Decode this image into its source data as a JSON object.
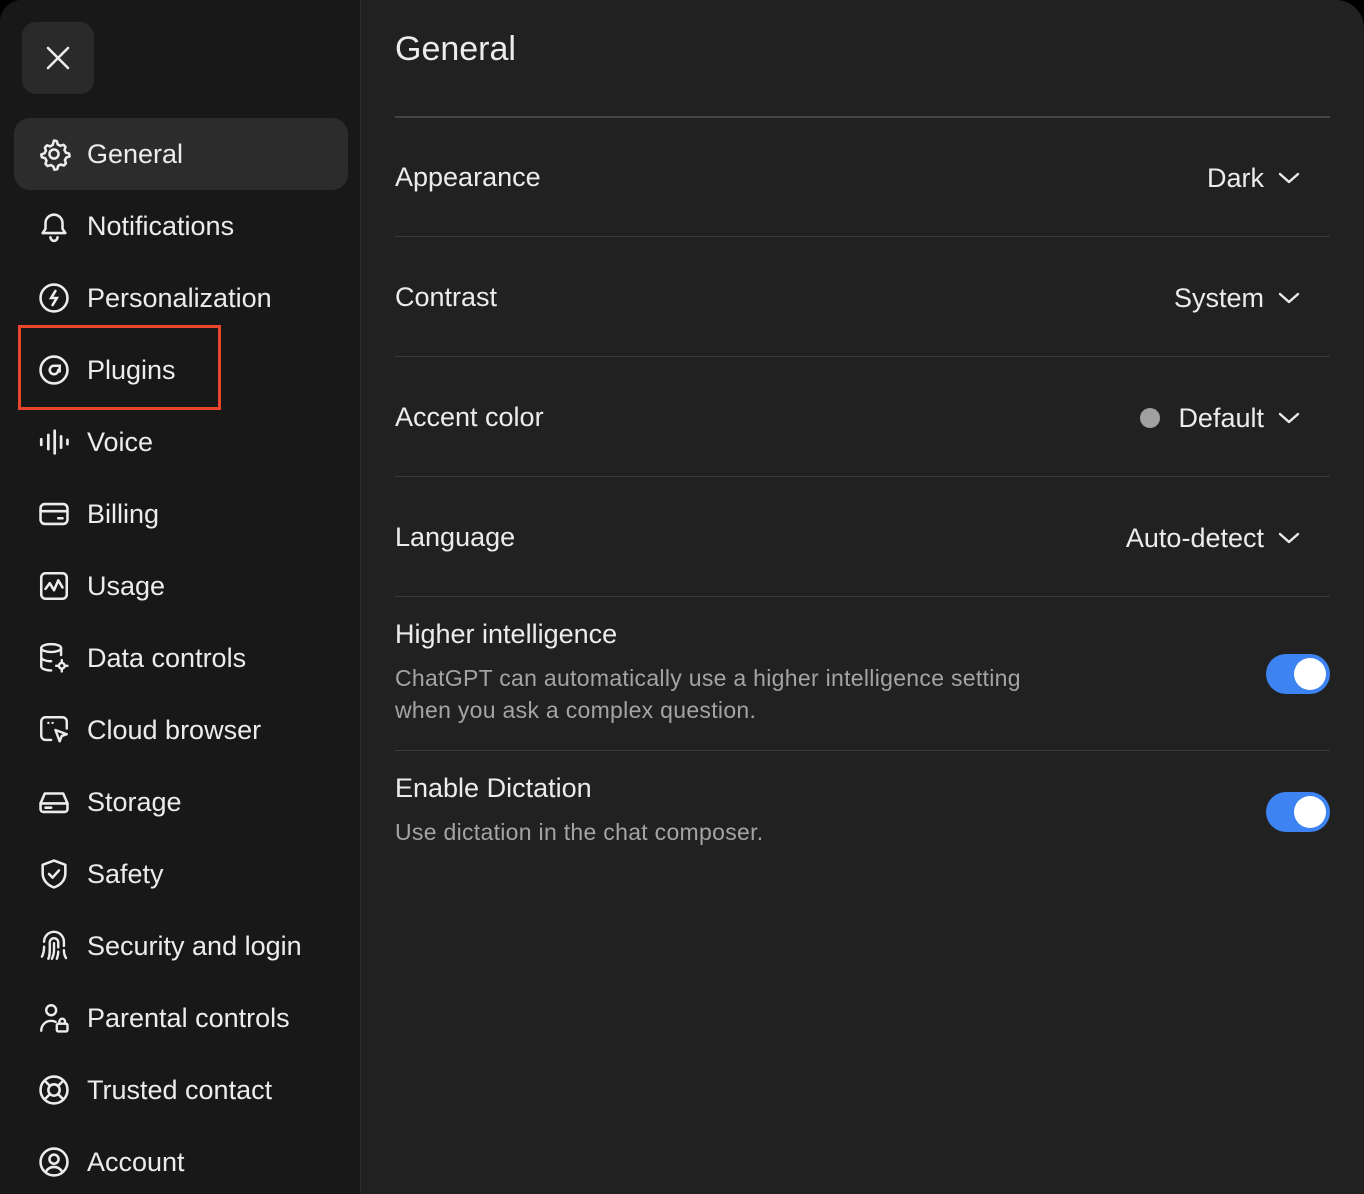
{
  "window": {
    "close_icon": "x-icon"
  },
  "sidebar": {
    "items": [
      {
        "label": "General",
        "icon": "gear-icon",
        "active": true
      },
      {
        "label": "Notifications",
        "icon": "bell-icon"
      },
      {
        "label": "Personalization",
        "icon": "personalization-icon"
      },
      {
        "label": "Plugins",
        "icon": "plugins-icon"
      },
      {
        "label": "Voice",
        "icon": "voice-waveform-icon"
      },
      {
        "label": "Billing",
        "icon": "credit-card-icon"
      },
      {
        "label": "Usage",
        "icon": "usage-chart-icon"
      },
      {
        "label": "Data controls",
        "icon": "database-gear-icon"
      },
      {
        "label": "Cloud browser",
        "icon": "cloud-browser-icon"
      },
      {
        "label": "Storage",
        "icon": "storage-drive-icon"
      },
      {
        "label": "Safety",
        "icon": "shield-check-icon"
      },
      {
        "label": "Security and login",
        "icon": "security-fingerprint-icon"
      },
      {
        "label": "Parental controls",
        "icon": "user-lock-icon"
      },
      {
        "label": "Trusted contact",
        "icon": "lifebuoy-icon"
      },
      {
        "label": "Account",
        "icon": "user-circle-icon"
      }
    ],
    "highlight_color": "#e8452c"
  },
  "main": {
    "title": "General",
    "settings": {
      "appearance": {
        "label": "Appearance",
        "value": "Dark"
      },
      "contrast": {
        "label": "Contrast",
        "value": "System"
      },
      "accent_color": {
        "label": "Accent color",
        "value": "Default",
        "dot_color": "#a0a0a0"
      },
      "language": {
        "label": "Language",
        "value": "Auto-detect"
      },
      "higher_intelligence": {
        "label": "Higher intelligence",
        "description": "ChatGPT can automatically use a higher intelligence setting when you ask a complex question.",
        "enabled": true
      },
      "dictation": {
        "label": "Enable Dictation",
        "description": "Use dictation in the chat composer.",
        "enabled": true
      }
    },
    "toggle_on_color": "#3e83f2"
  }
}
